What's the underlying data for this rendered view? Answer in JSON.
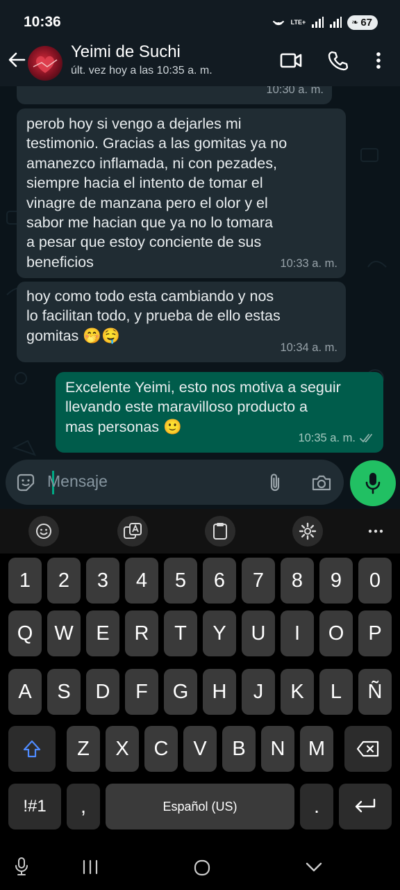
{
  "status_bar": {
    "time": "10:36",
    "network": "LTE+",
    "battery": "67"
  },
  "header": {
    "title": "Yeimi de Suchi",
    "last_seen": "últ. vez hoy a las 10:35 a. m."
  },
  "messages": [
    {
      "direction": "in",
      "text": "",
      "time": "10:30 a. m."
    },
    {
      "direction": "in",
      "text": "perob hoy si vengo a dejarles mi\ntestimonio. Gracias a las gomitas ya no\namanezco inflamada, ni con pezades,\nsiempre hacia el intento de tomar el\nvinagre de manzana pero el olor y el\nsabor me hacian que ya no lo tomara\na pesar que estoy conciente de sus\nbeneficios",
      "time": "10:33 a. m."
    },
    {
      "direction": "in",
      "text": "hoy como todo esta cambiando y nos\nlo facilitan todo, y prueba de ello estas\ngomitas 🤭🤤",
      "time": "10:34 a. m."
    },
    {
      "direction": "out",
      "text": "Excelente Yeimi, esto nos motiva a seguir\nllevando este maravilloso producto a\nmas personas 🙂",
      "time": "10:35 a. m.",
      "status": "read"
    }
  ],
  "composer": {
    "placeholder": "Mensaje"
  },
  "keyboard": {
    "row_numbers": [
      "1",
      "2",
      "3",
      "4",
      "5",
      "6",
      "7",
      "8",
      "9",
      "0"
    ],
    "row_1": [
      "Q",
      "W",
      "E",
      "R",
      "T",
      "Y",
      "U",
      "I",
      "O",
      "P"
    ],
    "row_2": [
      "A",
      "S",
      "D",
      "F",
      "G",
      "H",
      "J",
      "K",
      "L",
      "Ñ"
    ],
    "row_3": [
      "Z",
      "X",
      "C",
      "V",
      "B",
      "N",
      "M"
    ],
    "symbols_key": "!#1",
    "comma_key": ",",
    "space_label": "Español (US)",
    "period_key": "."
  },
  "colors": {
    "background": "#0b141a",
    "header": "#121b22",
    "incoming_bubble": "#202c33",
    "outgoing_bubble": "#005c4b",
    "accent_green": "#21c063",
    "read_ticks": "#53bdeb"
  }
}
